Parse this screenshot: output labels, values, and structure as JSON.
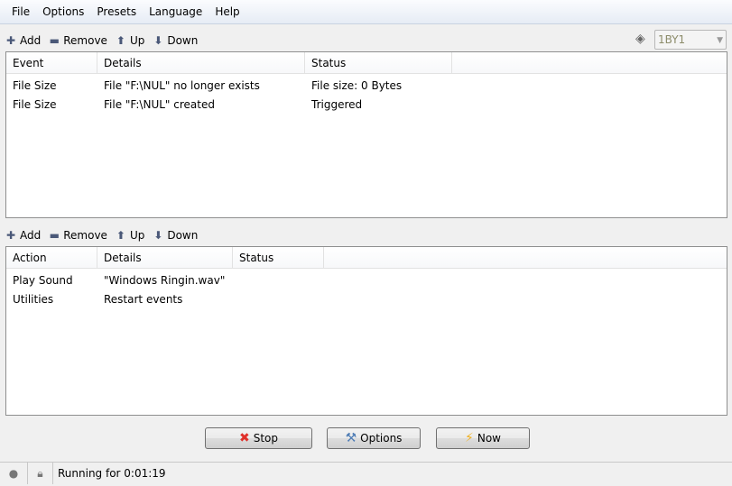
{
  "menu": [
    "File",
    "Options",
    "Presets",
    "Language",
    "Help"
  ],
  "events_toolbar": {
    "add": "Add",
    "remove": "Remove",
    "up": "Up",
    "down": "Down"
  },
  "preset_combo": {
    "value": "1BY1"
  },
  "events": {
    "columns": [
      "Event",
      "Details",
      "Status"
    ],
    "rows": [
      [
        "File Size",
        "File \"F:\\NUL\" no longer exists",
        "File size: 0 Bytes"
      ],
      [
        "File Size",
        "File \"F:\\NUL\" created",
        "Triggered"
      ]
    ]
  },
  "actions_toolbar": {
    "add": "Add",
    "remove": "Remove",
    "up": "Up",
    "down": "Down"
  },
  "actions": {
    "columns": [
      "Action",
      "Details",
      "Status"
    ],
    "rows": [
      [
        "Play Sound",
        "\"Windows Ringin.wav\"",
        ""
      ],
      [
        "Utilities",
        "Restart events",
        ""
      ]
    ]
  },
  "buttons": {
    "stop": "Stop",
    "options": "Options",
    "now": "Now"
  },
  "status": {
    "text": "Running for 0:01:19"
  }
}
